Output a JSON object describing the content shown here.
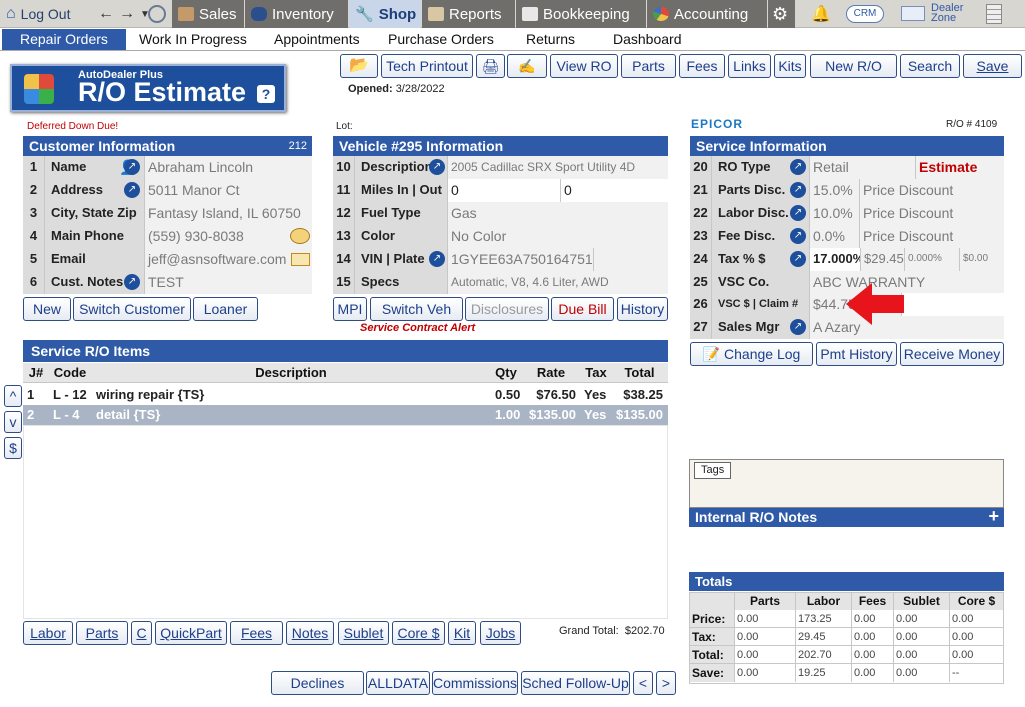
{
  "nav": {
    "logout": "Log Out",
    "sales": "Sales",
    "inventory": "Inventory",
    "shop": "Shop",
    "reports": "Reports",
    "bookkeeping": "Bookkeeping",
    "accounting": "Accounting",
    "crm": "CRM",
    "dealer_zone_1": "Dealer",
    "dealer_zone_2": "Zone"
  },
  "subnav": [
    "Repair Orders",
    "Work In Progress",
    "Appointments",
    "Purchase Orders",
    "Returns",
    "Dashboard"
  ],
  "logo": {
    "small": "AutoDealer Plus",
    "big": "R/O Estimate",
    "help": "?"
  },
  "toolbar": {
    "tech_printout": "Tech Printout",
    "view_ro": "View RO",
    "parts": "Parts",
    "fees": "Fees",
    "links": "Links",
    "kits": "Kits",
    "new_ro": "New R/O",
    "search": "Search",
    "save": "Save"
  },
  "opened_label": "Opened:",
  "opened_date": "3/28/2022",
  "deferred": "Deferred Down Due!",
  "lot_label": "Lot:",
  "epicor": "EPICOR",
  "ro_number": "R/O # 4109",
  "customer": {
    "title": "Customer Information",
    "id": "212",
    "rows": [
      {
        "n": "1",
        "label": "Name",
        "value": "Abraham Lincoln"
      },
      {
        "n": "2",
        "label": "Address",
        "value": "5011 Manor Ct"
      },
      {
        "n": "3",
        "label": "City, State Zip",
        "value": "Fantasy Island, IL 60750"
      },
      {
        "n": "4",
        "label": "Main Phone",
        "value": "(559) 930-8038"
      },
      {
        "n": "5",
        "label": "Email",
        "value": "jeff@asnsoftware.com"
      },
      {
        "n": "6",
        "label": "Cust. Notes",
        "value": "TEST"
      }
    ],
    "buttons": {
      "new": "New",
      "switch": "Switch Customer",
      "loaner": "Loaner"
    }
  },
  "vehicle": {
    "title": "Vehicle #295 Information",
    "rows": [
      {
        "n": "10",
        "label": "Description",
        "value": "2005 Cadillac SRX Sport Utility 4D"
      },
      {
        "n": "11",
        "label": "Miles  In | Out",
        "value": "0",
        "value2": "0"
      },
      {
        "n": "12",
        "label": "Fuel Type",
        "value": "Gas"
      },
      {
        "n": "13",
        "label": "Color",
        "value": "No Color"
      },
      {
        "n": "14",
        "label": "VIN | Plate",
        "value": "1GYEE63A750164751"
      },
      {
        "n": "15",
        "label": "Specs",
        "value": "Automatic, V8, 4.6 Liter, AWD"
      }
    ],
    "buttons": {
      "mpi": "MPI",
      "switch": "Switch Veh",
      "disclosures": "Disclosures",
      "due_bill": "Due Bill",
      "history": "History"
    },
    "alert": "Service Contract Alert"
  },
  "service": {
    "title": "Service Information",
    "rows": [
      {
        "n": "20",
        "label": "RO Type",
        "value": "Retail",
        "extra": "Estimate"
      },
      {
        "n": "21",
        "label": "Parts Disc.",
        "value": "15.0%",
        "extra": "Price Discount"
      },
      {
        "n": "22",
        "label": "Labor Disc.",
        "value": "10.0%",
        "extra": "Price Discount"
      },
      {
        "n": "23",
        "label": "Fee Disc.",
        "value": "0.0%",
        "extra": "Price Discount"
      },
      {
        "n": "24",
        "label": "Tax % $",
        "value": "17.000%",
        "v2": "$29.45",
        "v3": "0.000%",
        "v4": "$0.00"
      },
      {
        "n": "25",
        "label": "VSC  Co.",
        "value": "ABC WARRANTY"
      },
      {
        "n": "26",
        "label": "VSC $ | Claim #",
        "value": "$44.75"
      },
      {
        "n": "27",
        "label": "Sales Mgr",
        "value": "A Azary"
      }
    ],
    "buttons": {
      "change_log": "Change Log",
      "pmt_history": "Pmt History",
      "receive_money": "Receive Money"
    }
  },
  "items": {
    "title": "Service R/O Items",
    "columns": [
      "J#",
      "Code",
      "Description",
      "Qty",
      "Rate",
      "Tax",
      "Total"
    ],
    "rows": [
      {
        "j": "1",
        "code": "L - 12",
        "desc": "wiring repair {TS}",
        "qty": "0.50",
        "rate": "$76.50",
        "tax": "Yes",
        "total": "$38.25"
      },
      {
        "j": "2",
        "code": "L - 4",
        "desc": "detail  {TS}",
        "qty": "1.00",
        "rate": "$135.00",
        "tax": "Yes",
        "total": "$135.00"
      }
    ],
    "side": [
      "^",
      "v",
      "$"
    ],
    "bottom": [
      "Labor",
      "Parts",
      "C",
      "QuickPart",
      "Fees",
      "Notes",
      "Sublet",
      "Core $",
      "Kit",
      "Jobs"
    ],
    "grand_total_label": "Grand Total:",
    "grand_total": "$202.70"
  },
  "footer_buttons": [
    "Declines",
    "ALLDATA",
    "Commissions",
    "Sched Follow-Up",
    "<",
    ">"
  ],
  "tags": "Tags",
  "notes_title": "Internal R/O Notes",
  "notes_plus": "+",
  "totals": {
    "title": "Totals",
    "columns": [
      "Parts",
      "Labor",
      "Fees",
      "Sublet",
      "Core $"
    ],
    "rows": [
      {
        "label": "Price:",
        "values": [
          "0.00",
          "173.25",
          "0.00",
          "0.00",
          "0.00"
        ]
      },
      {
        "label": "Tax:",
        "values": [
          "0.00",
          "29.45",
          "0.00",
          "0.00",
          "0.00"
        ]
      },
      {
        "label": "Total:",
        "values": [
          "0.00",
          "202.70",
          "0.00",
          "0.00",
          "0.00"
        ]
      },
      {
        "label": "Save:",
        "values": [
          "0.00",
          "19.25",
          "0.00",
          "0.00",
          "--"
        ]
      }
    ]
  },
  "colors": {
    "accent": "#2e5aa8",
    "alert": "#c00000",
    "arrow": "#e8141b"
  }
}
